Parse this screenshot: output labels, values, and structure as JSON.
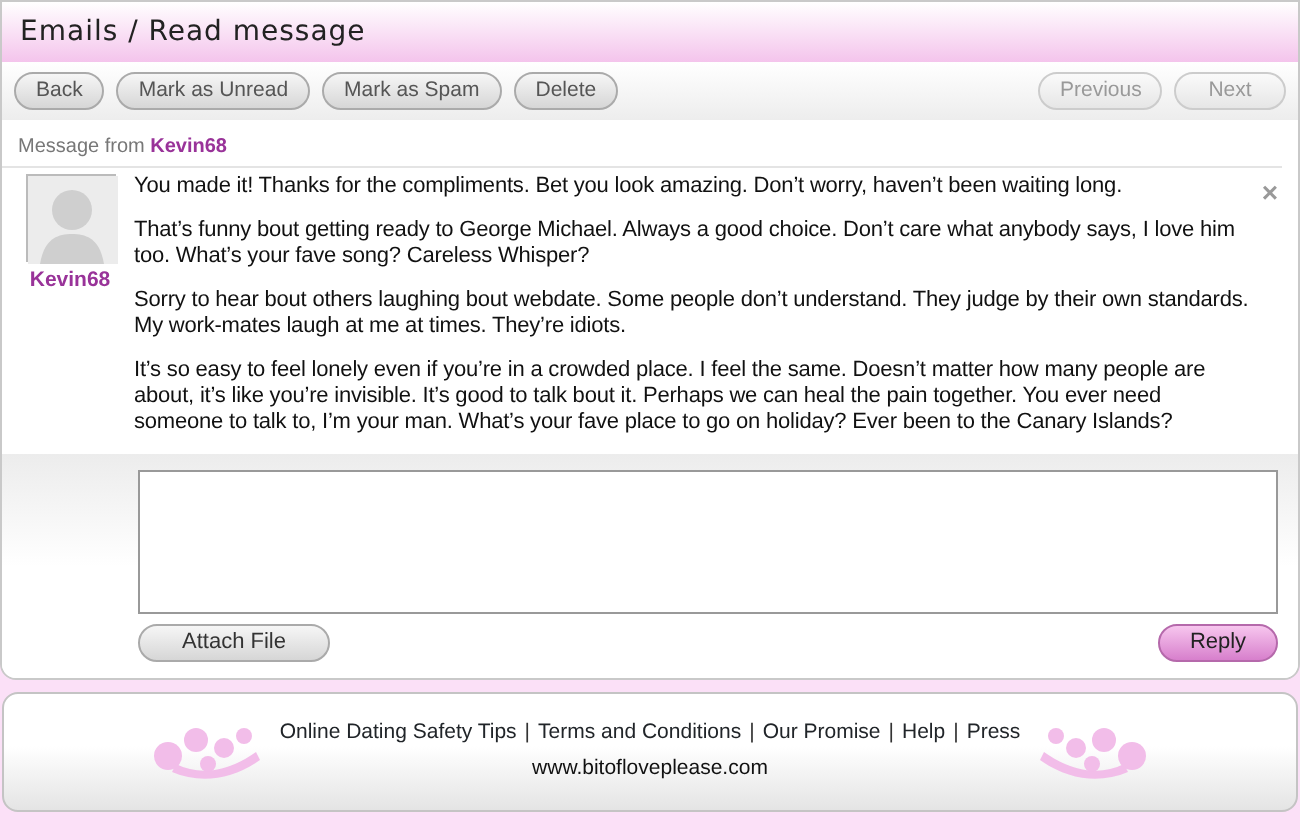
{
  "window": {
    "title": "Emails / Read message"
  },
  "toolbar": {
    "buttons": [
      {
        "label": "Back",
        "disabled": false
      },
      {
        "label": "Mark as Unread",
        "disabled": false
      },
      {
        "label": "Mark as Spam",
        "disabled": false
      },
      {
        "label": "Delete",
        "disabled": false
      }
    ],
    "nav_buttons": [
      {
        "label": "Previous",
        "disabled": true
      },
      {
        "label": "Next",
        "disabled": true
      }
    ]
  },
  "message": {
    "from_label": "Message from",
    "sender": "Kevin68",
    "avatar_name": "Kevin68",
    "close": "×",
    "paragraphs": [
      "You made it! Thanks for the compliments. Bet you look amazing. Don’t worry, haven’t been waiting long.",
      "That’s funny bout getting ready to George Michael. Always a good choice. Don’t care what anybody says, I love him too. What’s your fave song? Careless Whisper?",
      "Sorry to hear bout others laughing bout webdate. Some people don’t understand. They judge by their own standards. My work-mates laugh at me at times. They’re idiots.",
      "It’s so easy to feel lonely even if you’re in a crowded place. I feel the same. Doesn’t matter how many people are about, it’s like you’re invisible. It’s good to talk bout it. Perhaps we can heal the pain together. You ever need someone to talk to, I’m your man.  What’s your fave place to go on holiday? Ever been to the Canary Islands?"
    ]
  },
  "reply": {
    "attach_button": "Attach File",
    "reply_button": "Reply"
  },
  "footer": {
    "items": [
      {
        "kind": "link",
        "text": "Online Dating Safety Tips"
      },
      {
        "kind": "separator",
        "text": "|"
      },
      {
        "kind": "link",
        "text": "Terms and Conditions"
      },
      {
        "kind": "separator",
        "text": "|"
      },
      {
        "kind": "link",
        "text": "Our Promise"
      },
      {
        "kind": "separator",
        "text": "|"
      },
      {
        "kind": "link",
        "text": "Help"
      },
      {
        "kind": "separator",
        "text": "|"
      },
      {
        "kind": "link",
        "text": "Press"
      }
    ],
    "site": "www.bitofloveplease.com"
  }
}
